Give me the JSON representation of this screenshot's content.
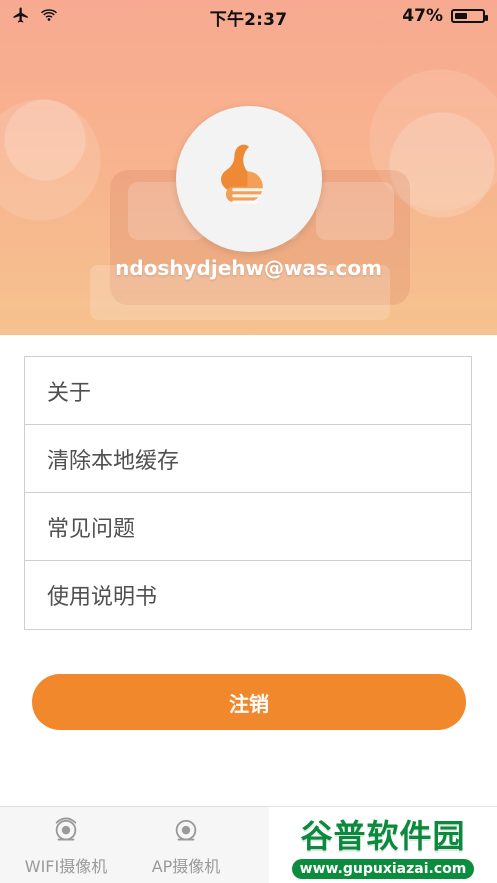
{
  "status_bar": {
    "time": "下午2:37",
    "battery_text": "47%",
    "battery_level": 0.47
  },
  "profile": {
    "email": "ndoshydjehw@was.com"
  },
  "menu": {
    "items": [
      {
        "label": "关于"
      },
      {
        "label": "清除本地缓存"
      },
      {
        "label": "常见问题"
      },
      {
        "label": "使用说明书"
      }
    ]
  },
  "actions": {
    "logout_label": "注销"
  },
  "tabbar": {
    "tabs": [
      {
        "label": "WIFI摄像机"
      },
      {
        "label": "AP摄像机"
      }
    ]
  },
  "watermark": {
    "title": "谷普软件园",
    "url": "www.gupuxiazai.com"
  },
  "colors": {
    "accent": "#f1882b"
  }
}
